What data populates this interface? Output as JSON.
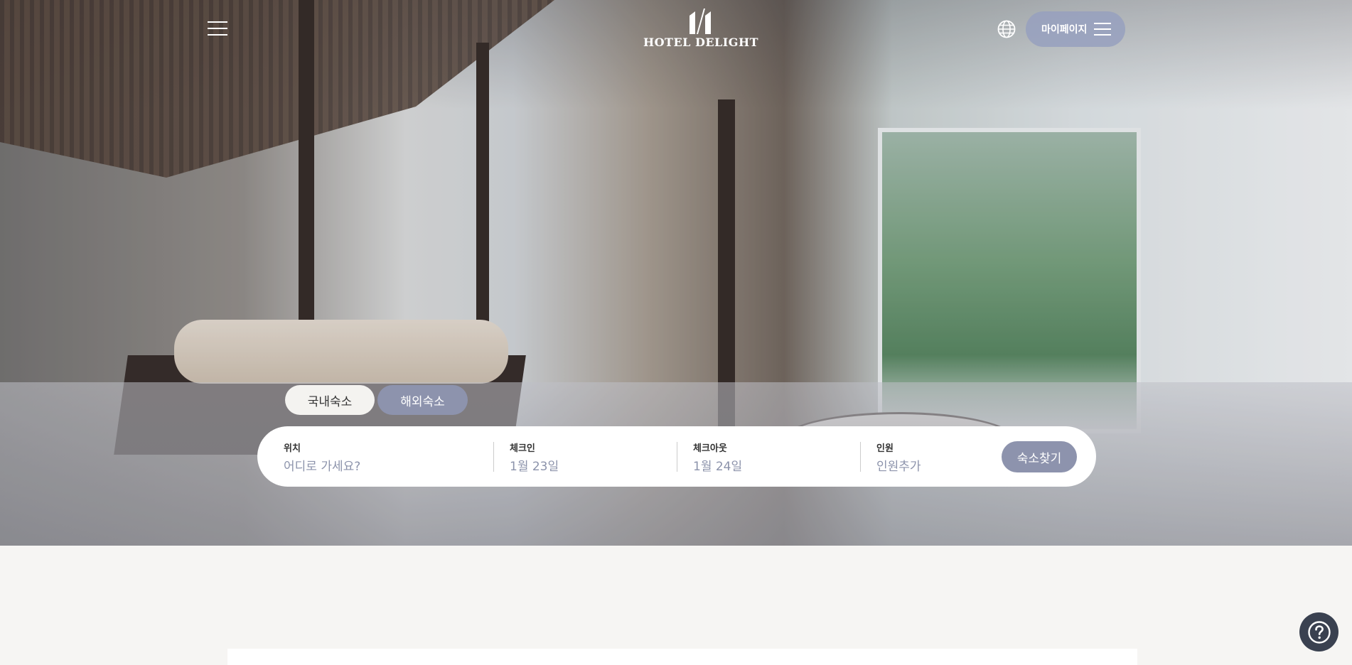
{
  "header": {
    "logo_text": "HOTEL DELIGHT",
    "mypage_label": "마이페이지"
  },
  "tabs": [
    {
      "label": "국내숙소",
      "active": false
    },
    {
      "label": "해외숙소",
      "active": true
    }
  ],
  "search": {
    "location_label": "위치",
    "location_placeholder": "어디로 가세요?",
    "checkin_label": "체크인",
    "checkin_value": "1월 23일",
    "checkout_label": "체크아웃",
    "checkout_value": "1월 24일",
    "guests_label": "인원",
    "guests_value": "인원추가",
    "submit_label": "숙소찾기"
  },
  "colors": {
    "accent": "#8d93ad",
    "help_button": "#3a4150",
    "page_background": "#f6f5f3"
  },
  "icons": {
    "menu": "menu-icon",
    "globe": "globe-icon",
    "help": "help-icon"
  }
}
